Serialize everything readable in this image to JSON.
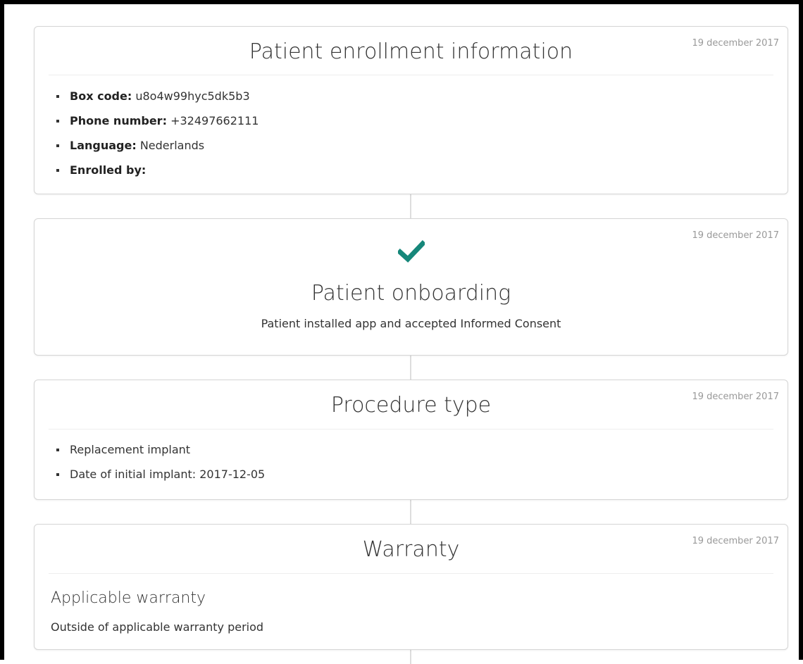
{
  "accent_color": "#16877a",
  "cards": {
    "enrollment": {
      "date": "19 december 2017",
      "title": "Patient enrollment information",
      "items": [
        {
          "label": "Box code:",
          "value": "u8o4w99hyc5dk5b3"
        },
        {
          "label": "Phone number:",
          "value": "+32497662111"
        },
        {
          "label": "Language:",
          "value": "Nederlands"
        },
        {
          "label": "Enrolled by:",
          "value": ""
        }
      ]
    },
    "onboarding": {
      "date": "19 december 2017",
      "icon": "checkmark-icon",
      "title": "Patient onboarding",
      "text": "Patient installed app and accepted Informed Consent"
    },
    "procedure": {
      "date": "19 december 2017",
      "title": "Procedure type",
      "items": [
        "Replacement implant",
        "Date of initial implant: 2017-12-05"
      ]
    },
    "warranty": {
      "date": "19 december 2017",
      "title": "Warranty",
      "subtitle": "Applicable warranty",
      "text": "Outside of applicable warranty period"
    }
  }
}
